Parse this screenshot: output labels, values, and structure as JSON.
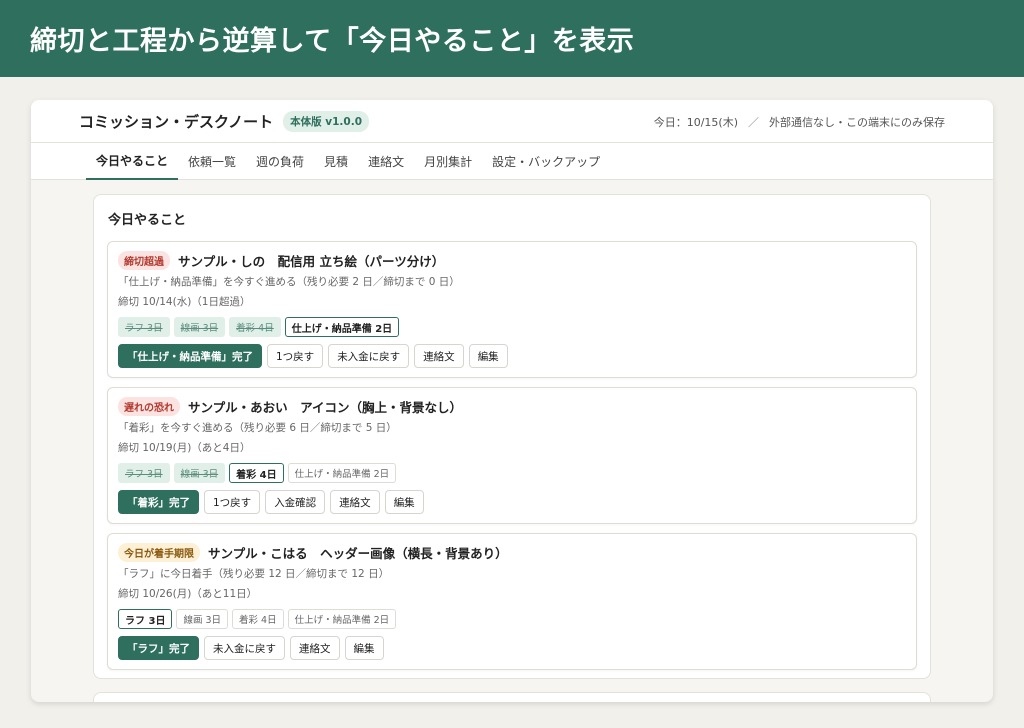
{
  "banner": {
    "title": "締切と工程から逆算して「今日やること」を表示"
  },
  "app": {
    "title": "コミッション・デスクノート",
    "version": "本体版 v1.0.0",
    "today": "今日：10/15(木)",
    "separator": "／",
    "storage": "外部通信なし・この端末にのみ保存"
  },
  "tabs": [
    {
      "label": "今日やること",
      "active": true
    },
    {
      "label": "依頼一覧"
    },
    {
      "label": "週の負荷"
    },
    {
      "label": "見積"
    },
    {
      "label": "連絡文"
    },
    {
      "label": "月別集計"
    },
    {
      "label": "設定・バックアップ"
    }
  ],
  "panel": {
    "title": "今日やること"
  },
  "cards": [
    {
      "status": "締切超過",
      "title": "サンプル・しの　配信用 立ち絵（パーツ分け）",
      "line1": "「仕上げ・納品準備」を今すぐ進める（残り必要 2 日／締切まで 0 日）",
      "line2": "締切 10/14(水)（1日超過）",
      "steps": [
        "ラフ 3日",
        "線画 3日",
        "着彩 4日",
        "仕上げ・納品準備 2日"
      ],
      "actions": [
        "「仕上げ・納品準備」完了",
        "1つ戻す",
        "未入金に戻す",
        "連絡文",
        "編集"
      ]
    },
    {
      "status": "遅れの恐れ",
      "title": "サンプル・あおい　アイコン（胸上・背景なし）",
      "line1": "「着彩」を今すぐ進める（残り必要 6 日／締切まで 5 日）",
      "line2": "締切 10/19(月)（あと4日）",
      "steps": [
        "ラフ 3日",
        "線画 3日",
        "着彩 4日",
        "仕上げ・納品準備 2日"
      ],
      "actions": [
        "「着彩」完了",
        "1つ戻す",
        "入金確認",
        "連絡文",
        "編集"
      ]
    },
    {
      "status": "今日が着手期限",
      "title": "サンプル・こはる　ヘッダー画像（横長・背景あり）",
      "line1": "「ラフ」に今日着手（残り必要 12 日／締切まで 12 日）",
      "line2": "締切 10/26(月)（あと11日）",
      "steps": [
        "ラフ 3日",
        "線画 3日",
        "着彩 4日",
        "仕上げ・納品準備 2日"
      ],
      "actions": [
        "「ラフ」完了",
        "未入金に戻す",
        "連絡文",
        "編集"
      ]
    }
  ]
}
